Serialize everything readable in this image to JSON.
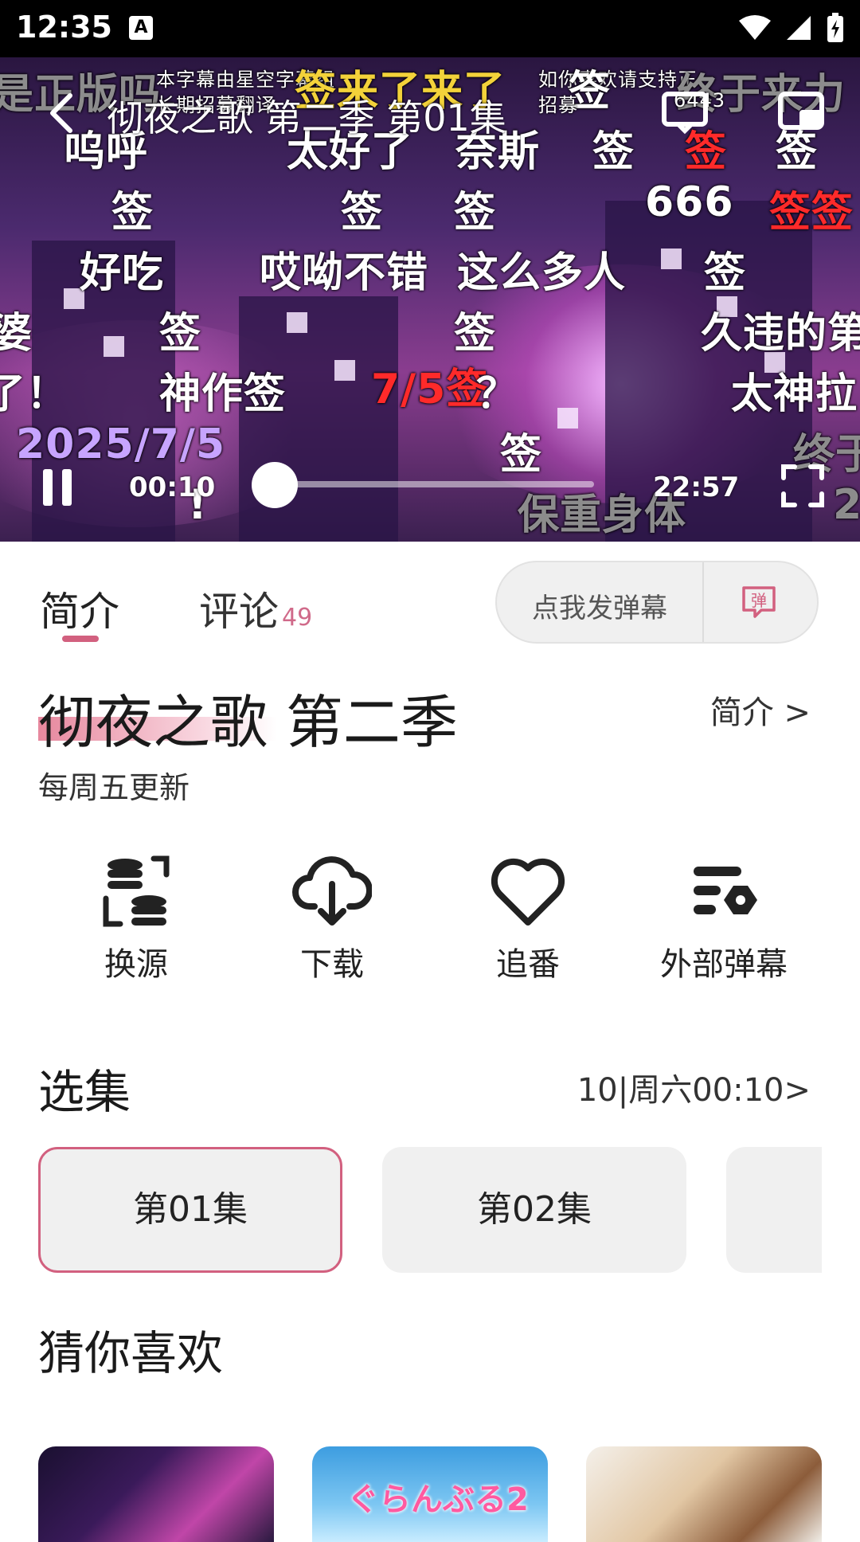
{
  "status_bar": {
    "time": "12:35",
    "notification_icon": "A"
  },
  "player": {
    "title": "彻夜之歌 第二季 第01集",
    "current_time": "00:10",
    "total_time": "22:57",
    "progress": 0.007,
    "danmaku": {
      "r1": "是正版吗",
      "r1b": "签来了来了",
      "r1c": "签",
      "r1d": "终于来力",
      "r1_note1": "本字幕由星空字幕组",
      "r1_note2": "如你喜欢请支持正",
      "r1_note3": "长期招募翻译",
      "r1_note4": "招募",
      "r1_note5": "6443",
      "r2a": "呜呼",
      "r2b": "太好了",
      "r2c": "奈斯",
      "r2d": "签",
      "r2e": "签",
      "r2f": "签",
      "r3a": "签",
      "r3b": "签",
      "r3c": "签",
      "r3d": "666",
      "r3e": "签签",
      "r4a": "好吃",
      "r4b": "哎呦不错",
      "r4c": "这么多人",
      "r4d": "签",
      "r5a": "婆",
      "r5b": "签",
      "r5c": "签",
      "r5d": "久违的第",
      "r6a": "了！",
      "r6b": "神作签",
      "r6c": "7/5签",
      "r6d": "？",
      "r6e": "太神拉",
      "r7a": "2025/7/5",
      "r7b": "签",
      "r7c": "终于",
      "r8a": "!",
      "r8b": "保重身体",
      "r8c": "2"
    }
  },
  "tabs": {
    "intro": "简介",
    "comments": "评论",
    "comments_count": "49"
  },
  "danmaku_input": {
    "placeholder": "点我发弹幕",
    "icon_label": "弹"
  },
  "anime": {
    "title": "彻夜之歌 第二季",
    "intro_link": "简介 >",
    "update_note": "每周五更新"
  },
  "actions": {
    "switch_source": "换源",
    "download": "下载",
    "follow": "追番",
    "external_danmaku": "外部弹幕"
  },
  "episodes": {
    "title": "选集",
    "schedule": "10|周六00:10>",
    "items": [
      "第01集",
      "第02集"
    ]
  },
  "recommendations": {
    "title": "猜你喜欢",
    "badge2": "ぐらんぶる2"
  },
  "colors": {
    "accent": "#d2607f",
    "danmaku_red": "#ff2a2a",
    "danmaku_yellow": "#f3d23a"
  }
}
